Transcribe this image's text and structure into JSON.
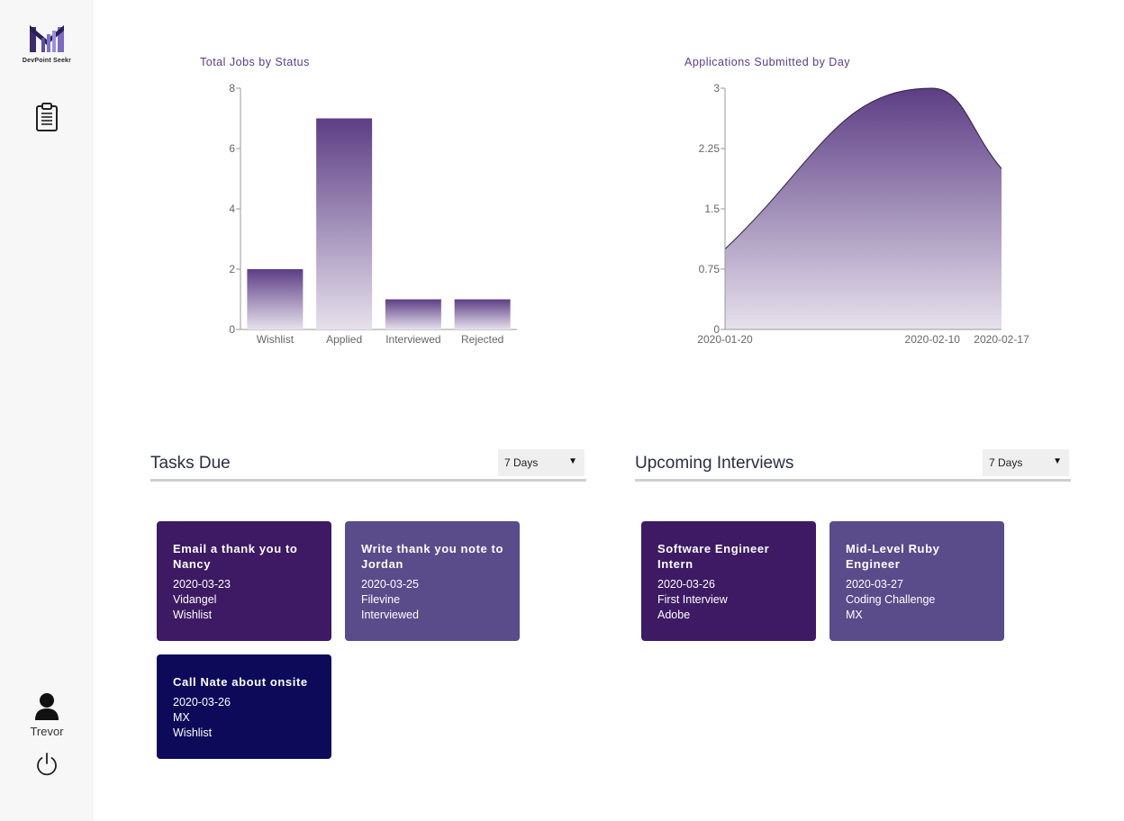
{
  "app": {
    "logo_text": "DevPoint Seekr"
  },
  "sidebar": {
    "user_name": "Trevor",
    "nav_icon": "clipboard-icon",
    "avatar_icon": "user-icon",
    "logout_icon": "power-icon"
  },
  "colors": {
    "purple_dark": "#3d1a63",
    "purple_mid": "#5a4b8b",
    "navy": "#0d0a5a",
    "chart_top": "#5d3d85",
    "chart_bottom": "#e6e1ec",
    "text_title": "#5b3b8c"
  },
  "chart_data": [
    {
      "type": "bar",
      "title": "Total Jobs by Status",
      "categories": [
        "Wishlist",
        "Applied",
        "Interviewed",
        "Rejected"
      ],
      "values": [
        2,
        7,
        1,
        1
      ],
      "ylim": [
        0,
        8
      ],
      "yticks": [
        0,
        2,
        4,
        6,
        8
      ],
      "ytick_labels": [
        "0",
        "2",
        "4",
        "6",
        "8"
      ],
      "grid": false
    },
    {
      "type": "area",
      "title": "Applications Submitted by Day",
      "x": [
        "2020-01-20",
        "2020-02-10",
        "2020-02-17"
      ],
      "y": [
        1,
        3,
        2
      ],
      "ylim": [
        0,
        3
      ],
      "yticks": [
        0,
        0.75,
        1.5,
        2.25,
        3
      ],
      "ytick_labels": [
        "0",
        "0.75",
        "1.5",
        "2.25",
        "3"
      ],
      "grid": false
    }
  ],
  "tasks": {
    "title": "Tasks Due",
    "filter_value": "7 Days",
    "cards": [
      {
        "title": "Email a thank you to Nancy",
        "date": "2020-03-23",
        "line2": "Vidangel",
        "line3": "Wishlist",
        "color": "#3d1a63"
      },
      {
        "title": "Write thank you note to Jordan",
        "date": "2020-03-25",
        "line2": "Filevine",
        "line3": "Interviewed",
        "color": "#5a4b8b"
      },
      {
        "title": "Call Nate about onsite",
        "date": "2020-03-26",
        "line2": "MX",
        "line3": "Wishlist",
        "color": "#0d0a5a"
      }
    ]
  },
  "interviews": {
    "title": "Upcoming Interviews",
    "filter_value": "7 Days",
    "cards": [
      {
        "title": "Software Engineer Intern",
        "date": "2020-03-26",
        "line2": "First Interview",
        "line3": "Adobe",
        "color": "#3d1a63"
      },
      {
        "title": "Mid-Level Ruby Engineer",
        "date": "2020-03-27",
        "line2": "Coding Challenge",
        "line3": "MX",
        "color": "#5a4b8b"
      }
    ]
  }
}
